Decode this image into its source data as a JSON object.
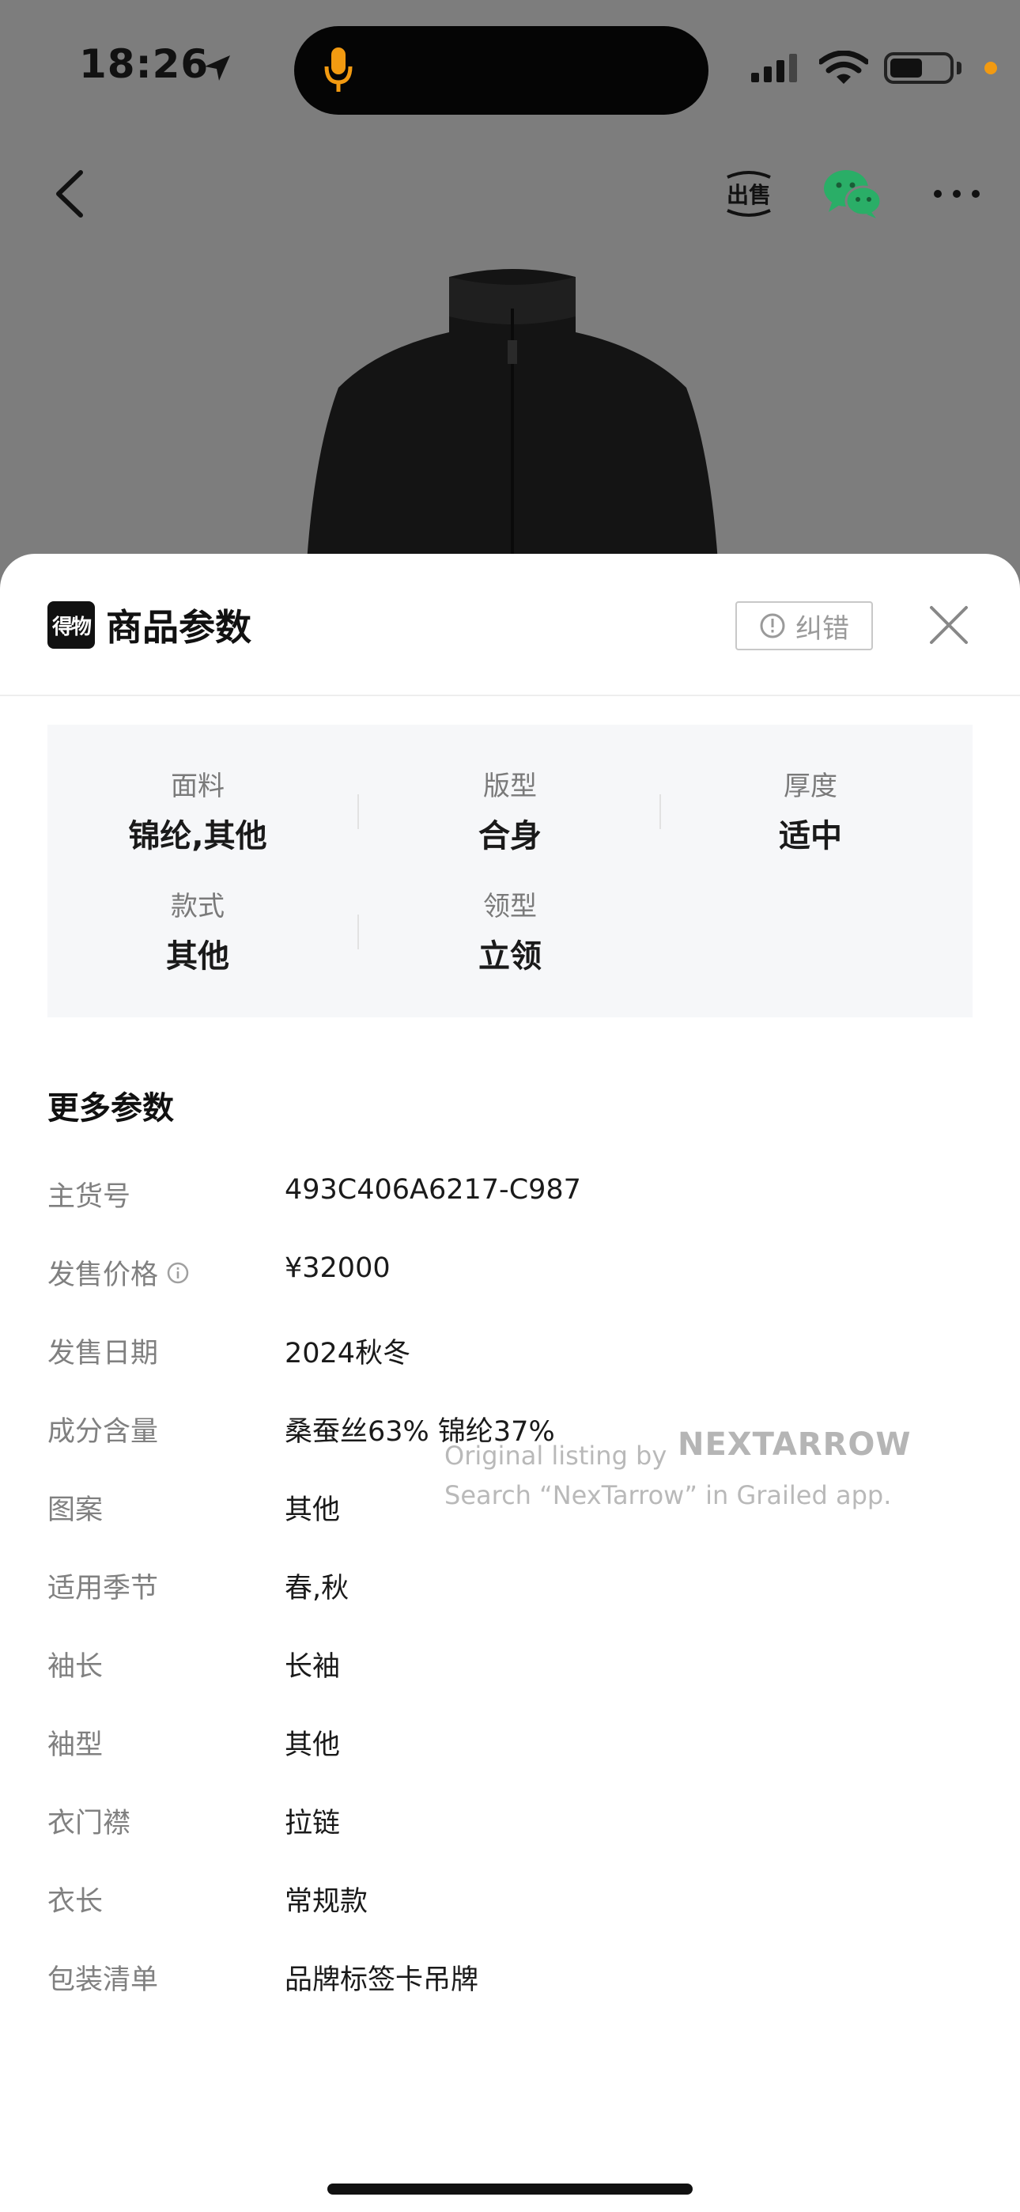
{
  "status_bar": {
    "time": "18:26"
  },
  "header_actions": {
    "sell_label": "出售"
  },
  "sheet": {
    "logo_text": "得物",
    "title": "商品参数",
    "report_label": "纠错",
    "params": [
      {
        "label": "面料",
        "value": "锦纶,其他"
      },
      {
        "label": "版型",
        "value": "合身"
      },
      {
        "label": "厚度",
        "value": "适中"
      },
      {
        "label": "款式",
        "value": "其他"
      },
      {
        "label": "领型",
        "value": "立领"
      }
    ],
    "more_title": "更多参数",
    "more_rows": [
      {
        "key": "主货号",
        "value": "493C406A6217-C987"
      },
      {
        "key": "发售价格",
        "value": "¥32000"
      },
      {
        "key": "发售日期",
        "value": "2024秋冬"
      },
      {
        "key": "成分含量",
        "value": "桑蚕丝63% 锦纶37%"
      },
      {
        "key": "图案",
        "value": "其他"
      },
      {
        "key": "适用季节",
        "value": "春,秋"
      },
      {
        "key": "袖长",
        "value": "长袖"
      },
      {
        "key": "袖型",
        "value": "其他"
      },
      {
        "key": "衣门襟",
        "value": "拉链"
      },
      {
        "key": "衣长",
        "value": "常规款"
      },
      {
        "key": "包装清单",
        "value": "品牌标签卡吊牌"
      }
    ]
  },
  "watermark": {
    "line1": "Original listing by",
    "brand": "NEXTARROW",
    "line2": "Search “NexTarrow” in Grailed app."
  },
  "colors": {
    "wechat_green": "#2aae67",
    "mic_orange": "#f29a11",
    "backdrop_gray": "#7d7d7d"
  }
}
